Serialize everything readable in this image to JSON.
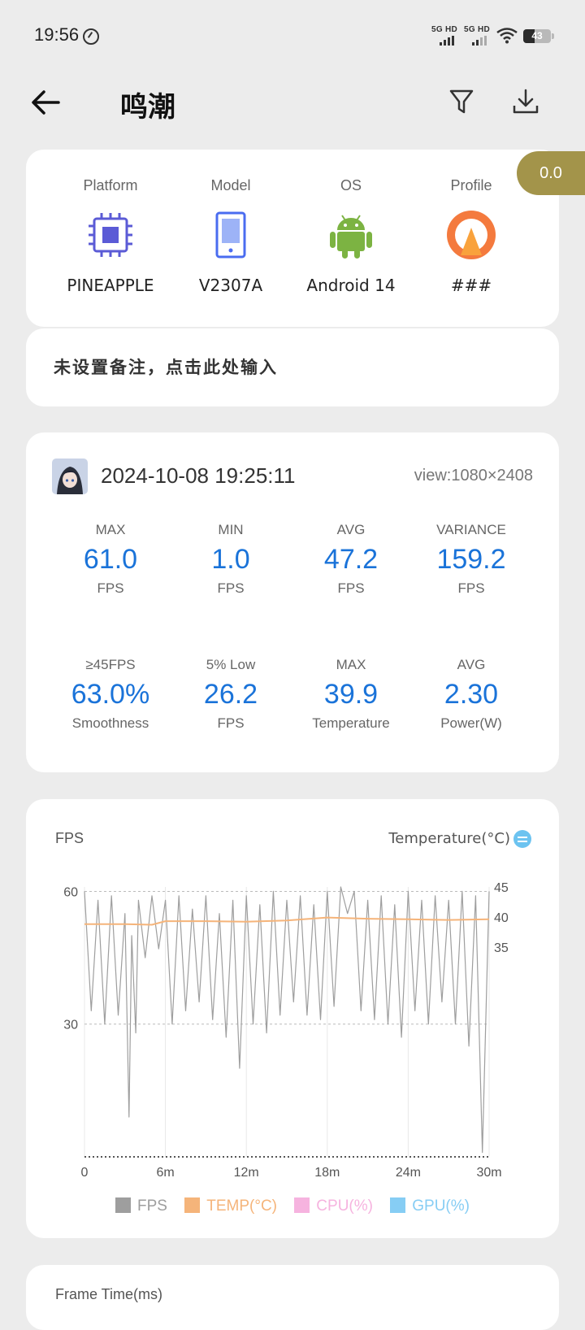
{
  "status_bar": {
    "time": "19:56",
    "net1": "5G HD",
    "net2": "5G HD",
    "battery": "43"
  },
  "appbar": {
    "title": "鸣潮",
    "back_icon": "arrow-left-icon",
    "filter_icon": "filter-icon",
    "download_icon": "download-icon"
  },
  "device": {
    "items": [
      {
        "label": "Platform",
        "value": "PINEAPPLE",
        "icon": "chip-icon"
      },
      {
        "label": "Model",
        "value": "V2307A",
        "icon": "phone-icon"
      },
      {
        "label": "OS",
        "value": "Android 14",
        "icon": "android-icon"
      },
      {
        "label": "Profile",
        "value": "###",
        "icon": "profile-gauge-icon"
      }
    ],
    "score": "0.0"
  },
  "note": {
    "placeholder": "未设置备注，点击此处输入"
  },
  "session": {
    "datetime": "2024-10-08 19:25:11",
    "view": "view:1080×2408",
    "metrics_row1": [
      {
        "label": "MAX",
        "value": "61.0",
        "unit": "FPS"
      },
      {
        "label": "MIN",
        "value": "1.0",
        "unit": "FPS"
      },
      {
        "label": "AVG",
        "value": "47.2",
        "unit": "FPS"
      },
      {
        "label": "VARIANCE",
        "value": "159.2",
        "unit": "FPS"
      }
    ],
    "metrics_row2": [
      {
        "label": "≥45FPS",
        "value": "63.0%",
        "unit": "Smoothness"
      },
      {
        "label": "5% Low",
        "value": "26.2",
        "unit": "FPS"
      },
      {
        "label": "MAX",
        "value": "39.9",
        "unit": "Temperature"
      },
      {
        "label": "AVG",
        "value": "2.30",
        "unit": "Power(W)"
      }
    ]
  },
  "chart": {
    "left_label": "FPS",
    "right_label": "Temperature(°C)",
    "legend": [
      {
        "label": "FPS",
        "color": "#9e9e9e"
      },
      {
        "label": "TEMP(°C)",
        "color": "#f5b47a"
      },
      {
        "label": "CPU(%)",
        "color": "#f6b3df"
      },
      {
        "label": "GPU(%)",
        "color": "#86cdf4"
      }
    ]
  },
  "chart_data": {
    "type": "line",
    "x_tick_labels": [
      "0",
      "6m",
      "12m",
      "18m",
      "24m",
      "30m"
    ],
    "y_left_ticks": [
      60,
      30
    ],
    "y_left_range": [
      0,
      61
    ],
    "y_right_ticks": [
      45,
      40,
      35
    ],
    "y_right_range": [
      0,
      45
    ],
    "x_range_minutes": [
      0,
      30
    ],
    "series": [
      {
        "name": "FPS",
        "axis": "left",
        "x": [
          0,
          0.5,
          1,
          1.5,
          2,
          2.5,
          3,
          3.3,
          3.5,
          3.8,
          4,
          4.5,
          5,
          5.5,
          6,
          6.5,
          7,
          7.5,
          8,
          8.5,
          9,
          9.5,
          10,
          10.5,
          11,
          11.5,
          12,
          12.5,
          13,
          13.5,
          14,
          14.5,
          15,
          15.5,
          16,
          16.5,
          17,
          17.5,
          18,
          18.5,
          19,
          19.5,
          20,
          20.5,
          21,
          21.5,
          22,
          22.5,
          23,
          23.5,
          24,
          24.5,
          25,
          25.5,
          26,
          26.5,
          27,
          27.5,
          28,
          28.5,
          29,
          29.5,
          30
        ],
        "values": [
          60,
          33,
          58,
          30,
          59,
          32,
          55,
          9,
          50,
          28,
          58,
          45,
          59,
          47,
          58,
          30,
          59,
          33,
          56,
          35,
          59,
          31,
          55,
          27,
          58,
          20,
          59,
          30,
          57,
          28,
          60,
          32,
          58,
          35,
          59,
          32,
          57,
          31,
          60,
          34,
          61,
          55,
          60,
          33,
          58,
          31,
          59,
          30,
          57,
          27,
          60,
          33,
          58,
          30,
          59,
          35,
          58,
          30,
          60,
          25,
          59,
          1,
          60
        ]
      },
      {
        "name": "TEMP(°C)",
        "axis": "right",
        "x": [
          0,
          3,
          5,
          6,
          9,
          12,
          15,
          18,
          21,
          24,
          27,
          30
        ],
        "values": [
          38.8,
          38.8,
          38.7,
          39.3,
          39.3,
          39.2,
          39.4,
          39.9,
          39.7,
          39.6,
          39.5,
          39.6
        ]
      }
    ]
  },
  "frame_time": {
    "label": "Frame Time(ms)"
  }
}
